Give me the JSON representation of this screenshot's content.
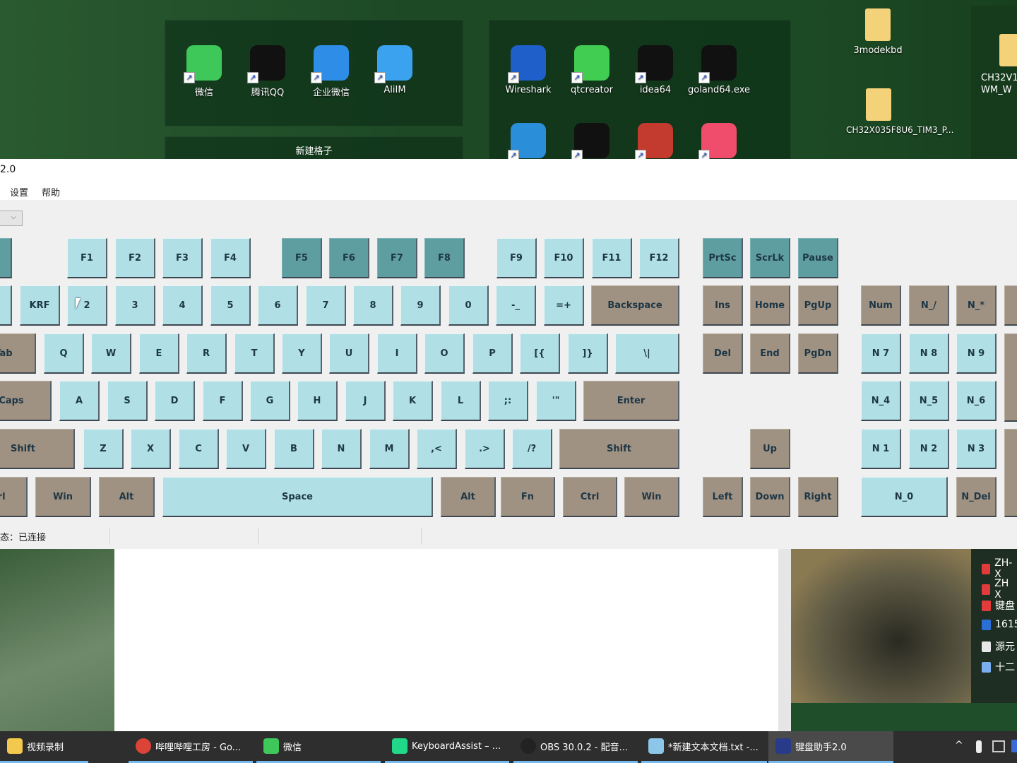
{
  "desktop": {
    "fence1": {
      "icons": [
        {
          "label": "微信",
          "icon": "wechat-icon",
          "color": "#3ec85a"
        },
        {
          "label": "腾讯QQ",
          "icon": "qq-penguin-icon",
          "color": "#111111"
        },
        {
          "label": "企业微信",
          "icon": "wecom-icon",
          "color": "#2e8de6"
        },
        {
          "label": "AliIM",
          "icon": "aliim-icon",
          "color": "#3aa2ef"
        }
      ]
    },
    "fence2_title": "新建格子",
    "fence3": {
      "icons": [
        {
          "label": "Wireshark",
          "icon": "wireshark-icon",
          "color": "#1e5fc9"
        },
        {
          "label": "qtcreator",
          "icon": "qtcreator-icon",
          "color": "#41cd52"
        },
        {
          "label": "idea64",
          "icon": "intellij-idea-icon",
          "color": "#111111"
        },
        {
          "label": "goland64.exe",
          "icon": "goland-icon",
          "color": "#111111"
        }
      ],
      "icons_row2": [
        {
          "icon": "vscode-icon",
          "color": "#2a8fd8"
        },
        {
          "icon": "clion-icon",
          "color": "#111111"
        },
        {
          "icon": "disk-tool-icon",
          "color": "#c23b2e"
        },
        {
          "icon": "pink-app-icon",
          "color": "#ef4d6b"
        }
      ]
    },
    "files": [
      {
        "label": "3modekbd",
        "icon": "folder-icon"
      },
      {
        "label": "CH32X035F8U6_TIM3_P...",
        "icon": "folder-icon"
      },
      {
        "label": "CH32V1 WM_W",
        "icon": "folder-icon"
      }
    ]
  },
  "window": {
    "title": "2.0",
    "menu": [
      "设置",
      "帮助"
    ],
    "combo_arrow": "⌵",
    "status": "态：已连接"
  },
  "keyboard": {
    "colors": {
      "light": "#b0e0e6",
      "brown": "#a09282",
      "teal": "#5f9ea0"
    },
    "rows": [
      [
        [
          "",
          "teal"
        ],
        [
          "F1",
          "light"
        ],
        [
          "F2",
          "light"
        ],
        [
          "F3",
          "light"
        ],
        [
          "F4",
          "light"
        ],
        [
          "F5",
          "teal"
        ],
        [
          "F6",
          "teal"
        ],
        [
          "F7",
          "teal"
        ],
        [
          "F8",
          "teal"
        ],
        [
          "F9",
          "light"
        ],
        [
          "F10",
          "light"
        ],
        [
          "F11",
          "light"
        ],
        [
          "F12",
          "light"
        ],
        [
          "PrtSc",
          "teal"
        ],
        [
          "ScrLk",
          "teal"
        ],
        [
          "Pause",
          "teal"
        ]
      ],
      [
        [
          "",
          "light"
        ],
        [
          "KRF",
          "light"
        ],
        [
          "2",
          "light"
        ],
        [
          "3",
          "light"
        ],
        [
          "4",
          "light"
        ],
        [
          "5",
          "light"
        ],
        [
          "6",
          "light"
        ],
        [
          "7",
          "light"
        ],
        [
          "8",
          "light"
        ],
        [
          "9",
          "light"
        ],
        [
          "0",
          "light"
        ],
        [
          "-_",
          "light"
        ],
        [
          "=+",
          "light"
        ],
        [
          "Backspace",
          "brown"
        ],
        [
          "Ins",
          "brown"
        ],
        [
          "Home",
          "brown"
        ],
        [
          "PgUp",
          "brown"
        ],
        [
          "Num",
          "brown"
        ],
        [
          "N_/",
          "brown"
        ],
        [
          "N_*",
          "brown"
        ],
        [
          "",
          "brown"
        ]
      ],
      [
        [
          "Tab",
          "brown"
        ],
        [
          "Q",
          "light"
        ],
        [
          "W",
          "light"
        ],
        [
          "E",
          "light"
        ],
        [
          "R",
          "light"
        ],
        [
          "T",
          "light"
        ],
        [
          "Y",
          "light"
        ],
        [
          "U",
          "light"
        ],
        [
          "I",
          "light"
        ],
        [
          "O",
          "light"
        ],
        [
          "P",
          "light"
        ],
        [
          "[{",
          "light"
        ],
        [
          "]}",
          "light"
        ],
        [
          "\\|",
          "light"
        ],
        [
          "Del",
          "brown"
        ],
        [
          "End",
          "brown"
        ],
        [
          "PgDn",
          "brown"
        ],
        [
          "N 7",
          "light"
        ],
        [
          "N 8",
          "light"
        ],
        [
          "N 9",
          "light"
        ],
        [
          "",
          "brown"
        ]
      ],
      [
        [
          "Caps",
          "brown"
        ],
        [
          "A",
          "light"
        ],
        [
          "S",
          "light"
        ],
        [
          "D",
          "light"
        ],
        [
          "F",
          "light"
        ],
        [
          "G",
          "light"
        ],
        [
          "H",
          "light"
        ],
        [
          "J",
          "light"
        ],
        [
          "K",
          "light"
        ],
        [
          "L",
          "light"
        ],
        [
          ";:",
          "light"
        ],
        [
          "'\"",
          "light"
        ],
        [
          "Enter",
          "brown"
        ],
        [
          "N_4",
          "light"
        ],
        [
          "N_5",
          "light"
        ],
        [
          "N_6",
          "light"
        ]
      ],
      [
        [
          "Shift",
          "brown"
        ],
        [
          "Z",
          "light"
        ],
        [
          "X",
          "light"
        ],
        [
          "C",
          "light"
        ],
        [
          "V",
          "light"
        ],
        [
          "B",
          "light"
        ],
        [
          "N",
          "light"
        ],
        [
          "M",
          "light"
        ],
        [
          ",<",
          "light"
        ],
        [
          ".>",
          "light"
        ],
        [
          "/?",
          "light"
        ],
        [
          "Shift",
          "brown"
        ],
        [
          "Up",
          "brown"
        ],
        [
          "N 1",
          "light"
        ],
        [
          "N 2",
          "light"
        ],
        [
          "N 3",
          "light"
        ],
        [
          "N",
          "brown"
        ]
      ],
      [
        [
          "trl",
          "brown"
        ],
        [
          "Win",
          "brown"
        ],
        [
          "Alt",
          "brown"
        ],
        [
          "Space",
          "light"
        ],
        [
          "Alt",
          "brown"
        ],
        [
          "Fn",
          "brown"
        ],
        [
          "Ctrl",
          "brown"
        ],
        [
          "Win",
          "brown"
        ],
        [
          "Left",
          "brown"
        ],
        [
          "Down",
          "brown"
        ],
        [
          "Right",
          "brown"
        ],
        [
          "N_0",
          "light"
        ],
        [
          "N_Del",
          "brown"
        ]
      ]
    ]
  },
  "right_files": [
    {
      "label": "ZH-X",
      "icon": "pdf-icon",
      "color": "#e23b3b"
    },
    {
      "label": "ZH X",
      "icon": "pdf-icon",
      "color": "#e23b3b"
    },
    {
      "label": "键盘",
      "icon": "pdf-icon",
      "color": "#e23b3b"
    },
    {
      "label": "1615",
      "icon": "word-icon",
      "color": "#2b6fd6"
    },
    {
      "label": "源元",
      "icon": "text-file-icon",
      "color": "#e8e8e8"
    },
    {
      "label": "十二",
      "icon": "file-icon",
      "color": "#7aaef0"
    }
  ],
  "taskbar": {
    "items": [
      {
        "label": "视频录制",
        "icon": "folder-icon",
        "color": "#f2c94c"
      },
      {
        "label": "哔哩哔哩工房 - Go...",
        "icon": "chrome-icon",
        "color": "#db4437"
      },
      {
        "label": "微信",
        "icon": "wechat-icon",
        "color": "#3ec85a"
      },
      {
        "label": "KeyboardAssist – ...",
        "icon": "clion-icon",
        "color": "#21d789"
      },
      {
        "label": "OBS 30.0.2 - 配音...",
        "icon": "obs-icon",
        "color": "#222222"
      },
      {
        "label": "*新建文本文档.txt -...",
        "icon": "notepad-icon",
        "color": "#8cc6e8"
      },
      {
        "label": "键盘助手2.0",
        "icon": "keyboard-assistant-icon",
        "color": "#2a3a8a"
      }
    ],
    "tray_chevron": "^"
  }
}
